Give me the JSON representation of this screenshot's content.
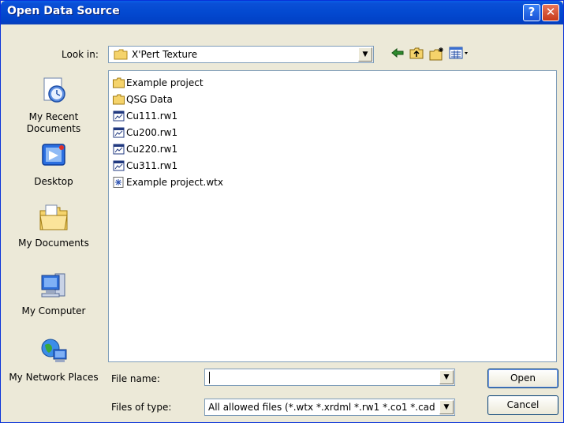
{
  "window": {
    "title": "Open Data Source"
  },
  "lookin": {
    "label": "Look in:",
    "value": "X'Pert Texture"
  },
  "toolbar": {
    "icons": [
      "back-arrow-icon",
      "up-folder-icon",
      "new-folder-icon",
      "view-menu-icon"
    ]
  },
  "places": [
    {
      "label": "My Recent Documents",
      "icon": "recent-documents-icon"
    },
    {
      "label": "Desktop",
      "icon": "desktop-icon"
    },
    {
      "label": "My Documents",
      "icon": "my-documents-icon"
    },
    {
      "label": "My Computer",
      "icon": "my-computer-icon"
    },
    {
      "label": "My Network Places",
      "icon": "network-places-icon"
    }
  ],
  "files": [
    {
      "name": "Example project",
      "type": "folder"
    },
    {
      "name": "QSG Data",
      "type": "folder"
    },
    {
      "name": "Cu111.rw1",
      "type": "data"
    },
    {
      "name": "Cu200.rw1",
      "type": "data"
    },
    {
      "name": "Cu220.rw1",
      "type": "data"
    },
    {
      "name": "Cu311.rw1",
      "type": "data"
    },
    {
      "name": "Example project.wtx",
      "type": "wtx"
    }
  ],
  "filename": {
    "label": "File name:",
    "value": ""
  },
  "filetype": {
    "label": "Files of type:",
    "value": "All allowed files (*.wtx *.xrdml *.rw1 *.co1 *.cad *"
  },
  "buttons": {
    "open": "Open",
    "cancel": "Cancel"
  },
  "colors": {
    "titlebar": "#0349d0",
    "dialog_bg": "#ece9d8",
    "folder_yellow": "#f5d36b",
    "border": "#7f9db9"
  }
}
